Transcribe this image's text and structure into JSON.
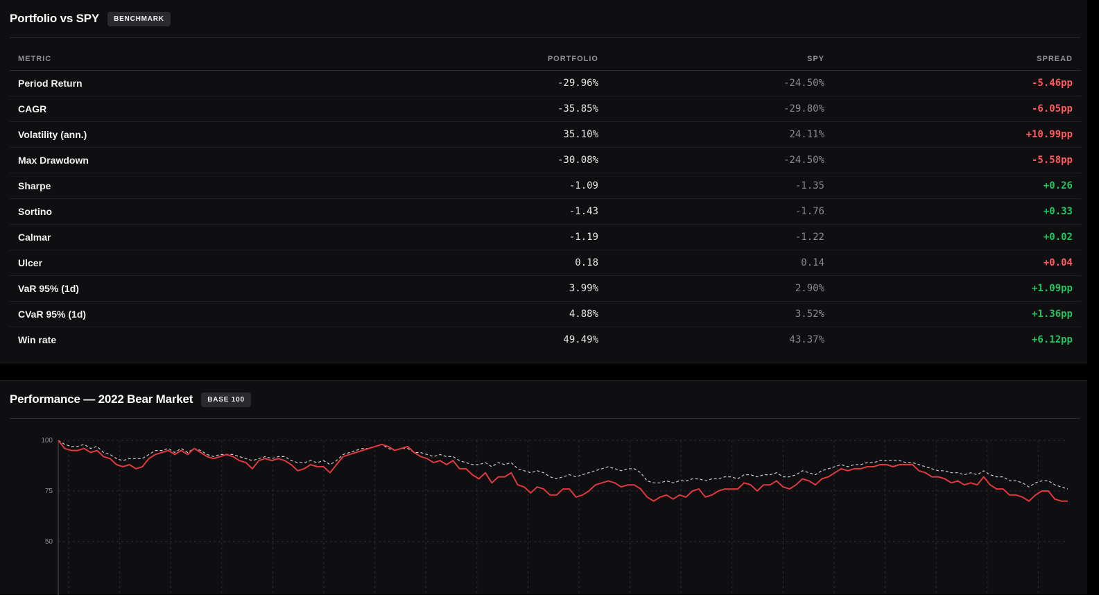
{
  "benchmark": {
    "title": "Portfolio vs SPY",
    "badge": "BENCHMARK",
    "columns": {
      "metric": "METRIC",
      "portfolio": "PORTFOLIO",
      "spy": "SPY",
      "spread": "SPREAD"
    },
    "rows": [
      {
        "metric": "Period Return",
        "portfolio": "-29.96%",
        "spy": "-24.50%",
        "spread": "-5.46pp",
        "tone": "neg"
      },
      {
        "metric": "CAGR",
        "portfolio": "-35.85%",
        "spy": "-29.80%",
        "spread": "-6.05pp",
        "tone": "neg"
      },
      {
        "metric": "Volatility (ann.)",
        "portfolio": "35.10%",
        "spy": "24.11%",
        "spread": "+10.99pp",
        "tone": "neg"
      },
      {
        "metric": "Max Drawdown",
        "portfolio": "-30.08%",
        "spy": "-24.50%",
        "spread": "-5.58pp",
        "tone": "neg"
      },
      {
        "metric": "Sharpe",
        "portfolio": "-1.09",
        "spy": "-1.35",
        "spread": "+0.26",
        "tone": "pos"
      },
      {
        "metric": "Sortino",
        "portfolio": "-1.43",
        "spy": "-1.76",
        "spread": "+0.33",
        "tone": "pos"
      },
      {
        "metric": "Calmar",
        "portfolio": "-1.19",
        "spy": "-1.22",
        "spread": "+0.02",
        "tone": "pos"
      },
      {
        "metric": "Ulcer",
        "portfolio": "0.18",
        "spy": "0.14",
        "spread": "+0.04",
        "tone": "neg"
      },
      {
        "metric": "VaR 95% (1d)",
        "portfolio": "3.99%",
        "spy": "2.90%",
        "spread": "+1.09pp",
        "tone": "pos"
      },
      {
        "metric": "CVaR 95% (1d)",
        "portfolio": "4.88%",
        "spy": "3.52%",
        "spread": "+1.36pp",
        "tone": "pos"
      },
      {
        "metric": "Win rate",
        "portfolio": "49.49%",
        "spy": "43.37%",
        "spread": "+6.12pp",
        "tone": "pos"
      }
    ]
  },
  "performance": {
    "title": "Performance — 2022 Bear Market",
    "badge": "BASE 100"
  },
  "colors": {
    "negative": "#ff5a5f",
    "positive": "#22c55e",
    "portfolio_line": "#e0383e",
    "spy_line": "#c9c9d0"
  },
  "chart_data": {
    "type": "line",
    "title": "",
    "xlabel": "",
    "ylabel": "",
    "ylim": [
      50,
      100
    ],
    "y_ticks": [
      50,
      75,
      100
    ],
    "grid": true,
    "series": [
      {
        "line_style": "solid",
        "values": [
          100,
          96,
          95,
          95,
          96,
          94,
          95,
          92,
          91,
          88,
          87,
          88,
          86,
          87,
          91,
          93,
          94,
          95,
          93,
          95,
          93,
          96,
          94,
          92,
          91,
          92,
          93,
          92,
          90,
          89,
          86,
          90,
          91,
          90,
          91,
          90,
          88,
          85,
          86,
          88,
          87,
          87,
          84,
          88,
          92,
          93,
          94,
          95,
          96,
          97,
          98,
          97,
          95,
          96,
          97,
          94,
          92,
          91,
          89,
          90,
          88,
          90,
          86,
          86,
          83,
          81,
          84,
          79,
          82,
          82,
          84,
          78,
          77,
          74,
          77,
          76,
          73,
          73,
          76,
          76,
          72,
          73,
          75,
          78,
          79,
          80,
          79,
          77,
          78,
          78,
          76,
          72,
          70,
          72,
          73,
          71,
          73,
          72,
          75,
          76,
          72,
          73,
          75,
          76,
          76,
          76,
          79,
          78,
          75,
          78,
          78,
          80,
          77,
          76,
          78,
          81,
          80,
          78,
          81,
          82,
          84,
          86,
          85,
          86,
          86,
          87,
          87,
          88,
          88,
          87,
          88,
          88,
          88,
          85,
          84,
          82,
          82,
          81,
          79,
          80,
          78,
          79,
          78,
          82,
          78,
          76,
          76,
          73,
          73,
          72,
          70,
          73,
          75,
          75,
          71,
          70,
          70
        ]
      },
      {
        "line_style": "dashed",
        "values": [
          100,
          98,
          97,
          97,
          98,
          96,
          97,
          94,
          93,
          91,
          90,
          91,
          91,
          91,
          93,
          95,
          95,
          96,
          94,
          96,
          94,
          96,
          95,
          93,
          92,
          93,
          93,
          93,
          92,
          91,
          90,
          91,
          92,
          91,
          92,
          92,
          90,
          89,
          89,
          90,
          89,
          90,
          88,
          90,
          93,
          94,
          95,
          96,
          96,
          97,
          98,
          96,
          95,
          96,
          96,
          94,
          94,
          93,
          92,
          93,
          92,
          92,
          90,
          89,
          88,
          88,
          89,
          87,
          89,
          88,
          89,
          86,
          85,
          84,
          85,
          84,
          82,
          81,
          82,
          83,
          82,
          83,
          84,
          85,
          86,
          87,
          86,
          85,
          86,
          86,
          84,
          80,
          79,
          79,
          80,
          79,
          80,
          80,
          81,
          81,
          80,
          81,
          81,
          82,
          82,
          81,
          83,
          83,
          82,
          83,
          83,
          84,
          82,
          82,
          83,
          85,
          84,
          83,
          85,
          86,
          87,
          88,
          87,
          88,
          88,
          89,
          89,
          90,
          90,
          90,
          90,
          89,
          89,
          88,
          87,
          86,
          85,
          85,
          84,
          84,
          83,
          84,
          83,
          85,
          83,
          82,
          82,
          80,
          80,
          79,
          77,
          79,
          80,
          80,
          78,
          77,
          76
        ]
      }
    ]
  }
}
